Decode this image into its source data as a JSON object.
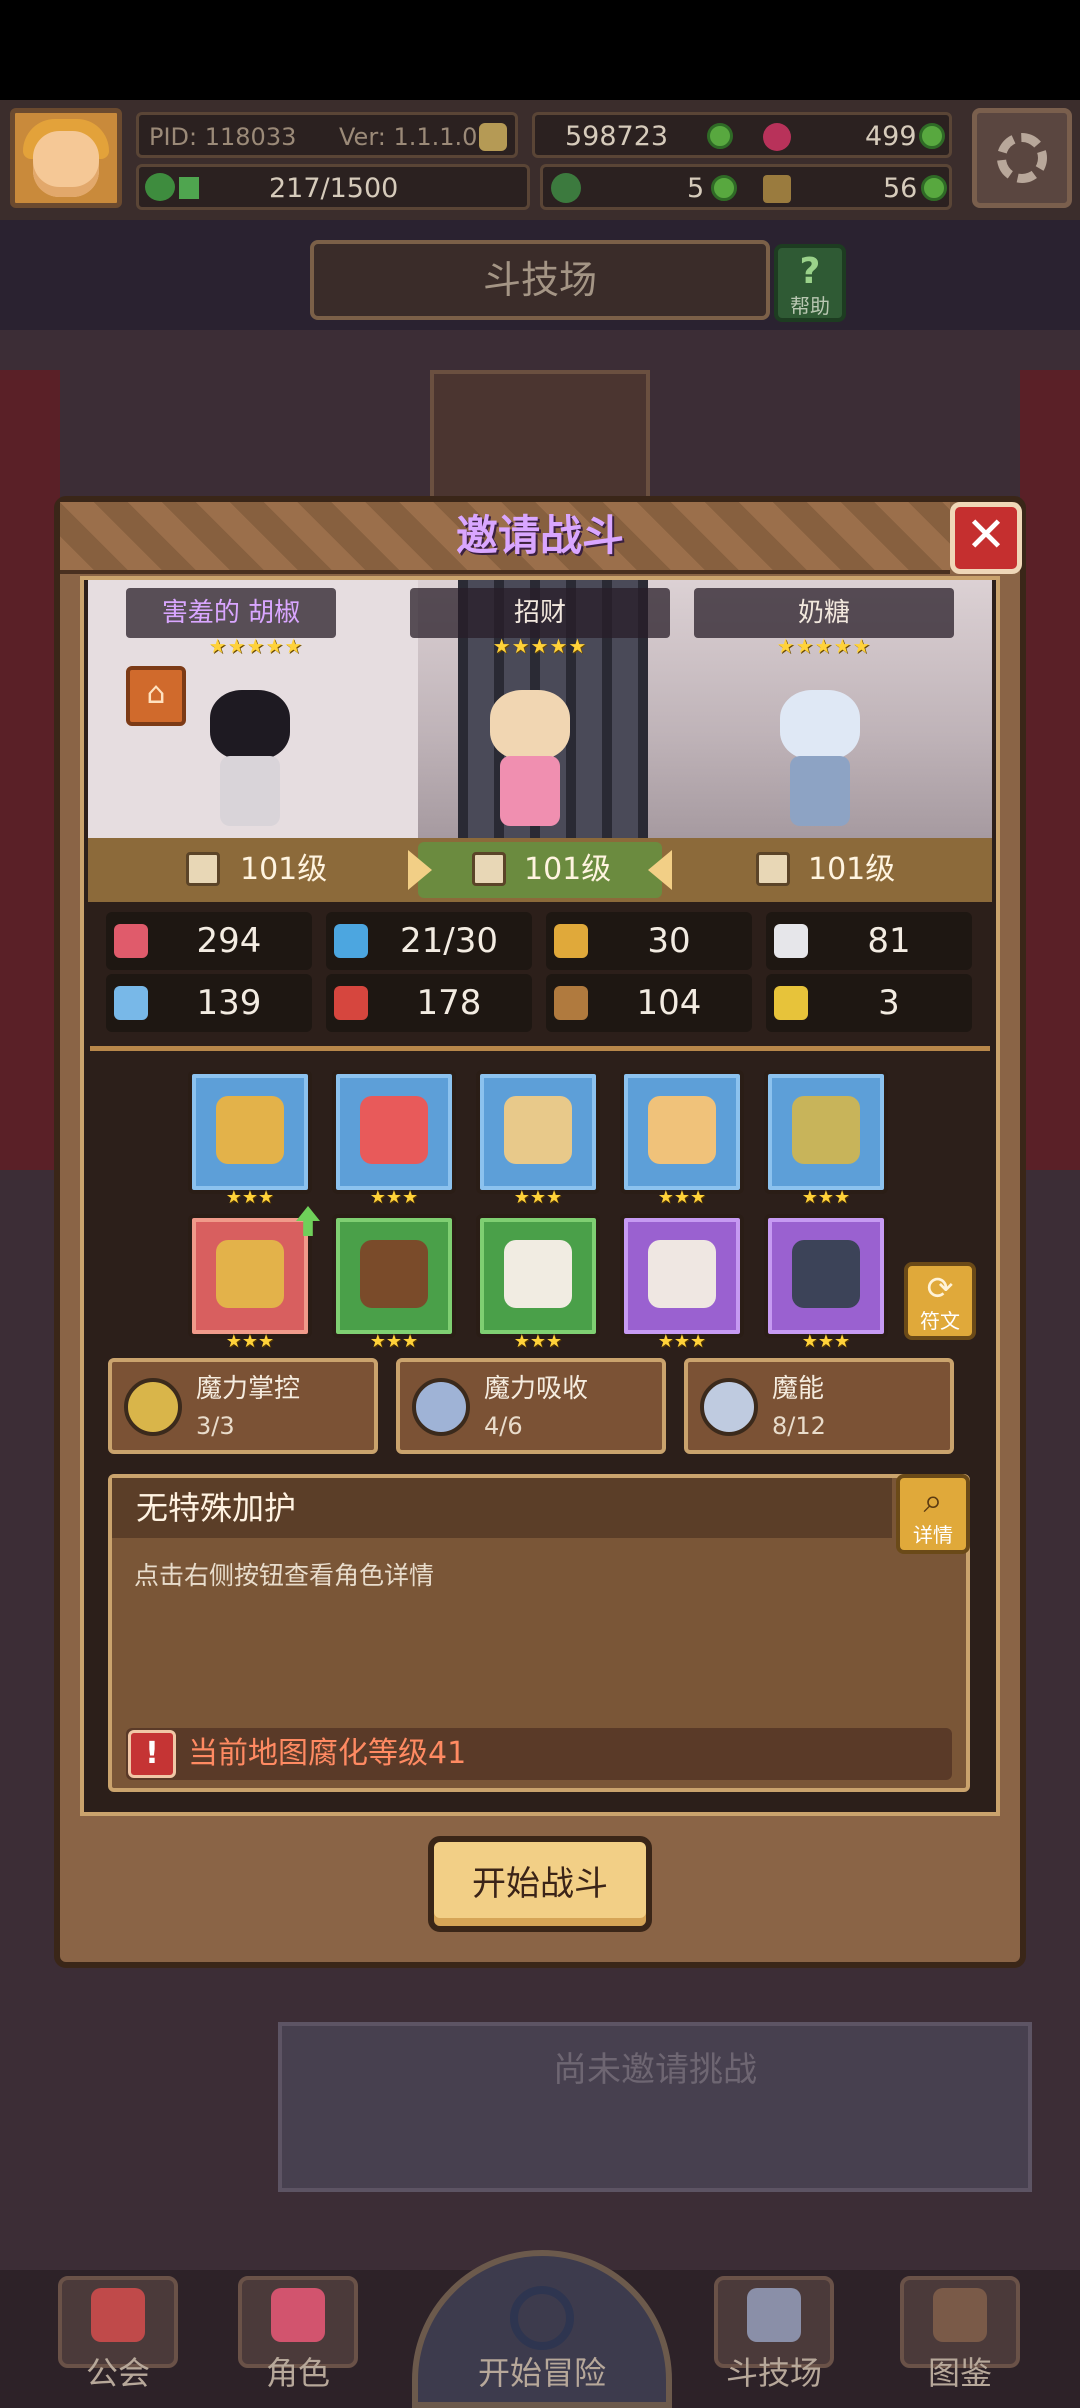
{
  "hud": {
    "pid": "PID: 118033",
    "version": "Ver: 1.1.1.0",
    "gold": "598723",
    "gems": "499",
    "exp": "217/1500",
    "clover": "5",
    "keys": "56"
  },
  "page": {
    "title": "斗技场",
    "help_label": "帮助"
  },
  "modal": {
    "title": "邀请战斗",
    "close": "✕",
    "heroes": [
      {
        "name": "害羞的 胡椒",
        "stars": "★★★★★",
        "level": "101级"
      },
      {
        "name": "招财",
        "stars": "★★★★★",
        "level": "101级"
      },
      {
        "name": "奶糖",
        "stars": "★★★★★",
        "level": "101级"
      }
    ],
    "stats": [
      {
        "icon": "heart-icon",
        "value": "294"
      },
      {
        "icon": "mana-drop-icon",
        "value": "21/30"
      },
      {
        "icon": "shield-icon",
        "value": "30"
      },
      {
        "icon": "wing-icon",
        "value": "81"
      },
      {
        "icon": "fist-icon",
        "value": "139"
      },
      {
        "icon": "spellbook-icon",
        "value": "178"
      },
      {
        "icon": "armor-icon",
        "value": "104"
      },
      {
        "icon": "horseshoe-icon",
        "value": "3"
      }
    ],
    "equipment_stars": "★★★",
    "rune_label": "符文",
    "magic": [
      {
        "name": "魔力掌控",
        "count": "3/3"
      },
      {
        "name": "魔力吸收",
        "count": "4/6"
      },
      {
        "name": "魔能",
        "count": "8/12"
      }
    ],
    "blessing_title": "无特殊加护",
    "detail_label": "详情",
    "blessing_desc": "点击右侧按钮查看角色详情",
    "warning": "当前地图腐化等级41",
    "start_button": "开始战斗"
  },
  "challenge_text": "尚未邀请挑战",
  "nav": {
    "guild": "公会",
    "character": "角色",
    "adventure": "开始冒险",
    "arena": "斗技场",
    "codex": "图鉴"
  },
  "colors": {
    "accent_purple": "#d9a6ff",
    "warning": "#ff8a62",
    "star": "#ffd23a"
  }
}
